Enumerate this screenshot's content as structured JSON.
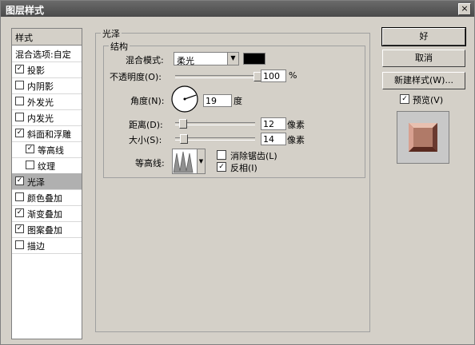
{
  "window": {
    "title": "图层样式",
    "close": "×"
  },
  "sidebar": {
    "header": "样式",
    "items": [
      {
        "label": "混合选项:自定",
        "checkbox": false,
        "checked": false,
        "indent": false
      },
      {
        "label": "投影",
        "checkbox": true,
        "checked": true,
        "indent": false
      },
      {
        "label": "内阴影",
        "checkbox": true,
        "checked": false,
        "indent": false
      },
      {
        "label": "外发光",
        "checkbox": true,
        "checked": false,
        "indent": false
      },
      {
        "label": "内发光",
        "checkbox": true,
        "checked": false,
        "indent": false
      },
      {
        "label": "斜面和浮雕",
        "checkbox": true,
        "checked": true,
        "indent": false
      },
      {
        "label": "等高线",
        "checkbox": true,
        "checked": true,
        "indent": true
      },
      {
        "label": "纹理",
        "checkbox": true,
        "checked": false,
        "indent": true
      },
      {
        "label": "光泽",
        "checkbox": true,
        "checked": true,
        "indent": false,
        "selected": true
      },
      {
        "label": "颜色叠加",
        "checkbox": true,
        "checked": false,
        "indent": false
      },
      {
        "label": "渐变叠加",
        "checkbox": true,
        "checked": true,
        "indent": false
      },
      {
        "label": "图案叠加",
        "checkbox": true,
        "checked": true,
        "indent": false
      },
      {
        "label": "描边",
        "checkbox": true,
        "checked": false,
        "indent": false
      }
    ]
  },
  "satin": {
    "group_title": "光泽",
    "structure_title": "结构",
    "blend_mode_label": "混合模式:",
    "blend_mode_value": "柔光",
    "opacity_label": "不透明度(O):",
    "opacity_value": "100",
    "opacity_unit": "%",
    "opacity_fraction": 1.0,
    "angle_label": "角度(N):",
    "angle_value": "19",
    "angle_unit": "度",
    "distance_label": "距离(D):",
    "distance_value": "12",
    "distance_unit": "像素",
    "size_label": "大小(S):",
    "size_value": "14",
    "size_unit": "像素",
    "contour_label": "等高线:",
    "antialias_label": "消除锯齿(L)",
    "antialias_checked": false,
    "invert_label": "反相(I)",
    "invert_checked": true,
    "swatch_color": "#000000"
  },
  "buttons": {
    "ok": "好",
    "cancel": "取消",
    "new_style": "新建样式(W)...",
    "preview_label": "预览(V)",
    "preview_checked": true
  },
  "icons": {
    "preview": "bevel-square-preview",
    "contour": "contour-thumbnail",
    "angle": "angle-dial",
    "dropdown": "chevron-down-icon"
  },
  "colors": {
    "preview_fill": "#b07a68",
    "titlebar": "#5a5a5a",
    "selected_row": "#b0b0b0"
  }
}
